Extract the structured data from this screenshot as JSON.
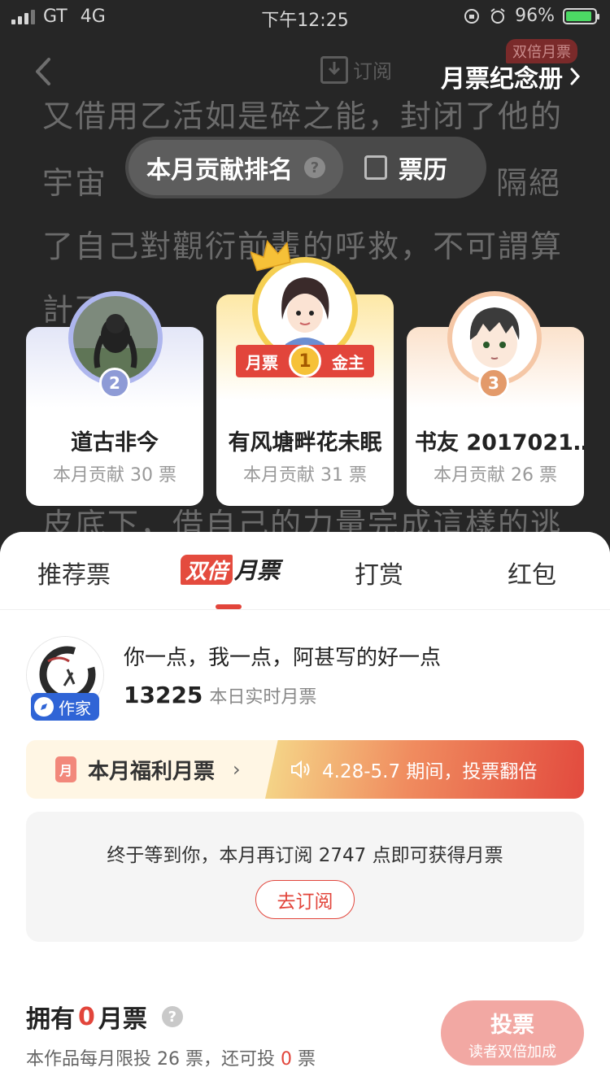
{
  "status_bar": {
    "carrier": "GT",
    "network": "4G",
    "time": "下午12:25",
    "battery_percent": "96%",
    "battery_level": 0.96
  },
  "nav": {
    "subscribe_label": "订阅",
    "double_tag": "双倍月票",
    "album_label": "月票纪念册"
  },
  "background_text": [
    "又借用乙活如是碎之能，封闭了他的",
    "宇宙",
    "隔絕",
    "了自己對觀衍前輩的呼救，不可謂算",
    "計不深",
    "皮底下，借自己的力量完成這樣的逃"
  ],
  "segment": {
    "active_label": "本月贡献排名",
    "other_label": "票历"
  },
  "ranking": {
    "first": {
      "rank": "1",
      "name": "有风塘畔花未眠",
      "contribution": "本月贡献 31 票",
      "ribbon_left": "月票",
      "ribbon_right": "金主"
    },
    "second": {
      "rank": "2",
      "name": "道古非今",
      "contribution": "本月贡献 30 票"
    },
    "third": {
      "rank": "3",
      "name": "书友 2017021…",
      "contribution": "本月贡献 26 票"
    }
  },
  "tabs": {
    "recommend": "推荐票",
    "double": "双倍",
    "monthly": "月票",
    "reward": "打赏",
    "redpack": "红包"
  },
  "author": {
    "badge": "作家",
    "message": "你一点，我一点，阿甚写的好一点",
    "count": "13225",
    "count_label": "本日实时月票"
  },
  "welfare": {
    "icon_text": "月",
    "title": "本月福利月票",
    "promo": "4.28-5.7 期间，投票翻倍"
  },
  "subscribe_prompt": {
    "message": "终于等到你，本月再订阅 2747 点即可获得月票",
    "button": "去订阅"
  },
  "own": {
    "prefix": "拥有",
    "count": "0",
    "suffix": "月票",
    "limit_prefix": "本作品每月限投 26 票，还可投",
    "limit_remaining": "0",
    "limit_suffix": "票"
  },
  "vote_button": {
    "label": "投票",
    "sub_label": "读者双倍加成"
  },
  "colors": {
    "accent": "#e2453b",
    "gold": "#f5cf52",
    "silver": "#aeb6ee",
    "bronze": "#f5c7a6"
  }
}
